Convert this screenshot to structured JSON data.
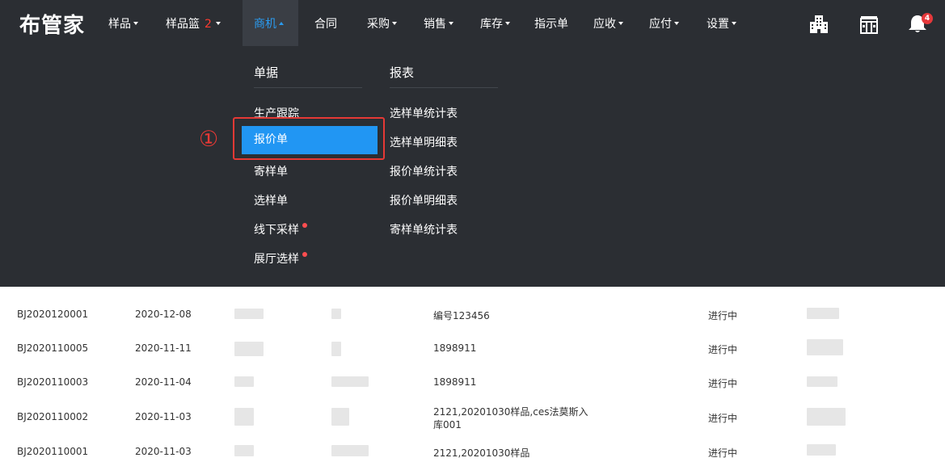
{
  "app": {
    "logo": "布管家"
  },
  "nav": {
    "items": [
      {
        "label": "样品"
      },
      {
        "label": "样品篮",
        "badge": "2"
      },
      {
        "label": "商机"
      },
      {
        "label": "合同"
      },
      {
        "label": "采购"
      },
      {
        "label": "销售"
      },
      {
        "label": "库存"
      },
      {
        "label": "指示单"
      },
      {
        "label": "应收"
      },
      {
        "label": "应付"
      },
      {
        "label": "设置"
      }
    ],
    "active_item": "商机",
    "icons": [
      "building-icon",
      "store-icon",
      "bell-icon"
    ],
    "notification_count": "4"
  },
  "dropdown": {
    "documents": {
      "title": "单据",
      "items": [
        "生产跟踪",
        "报价单",
        "寄样单",
        "选样单",
        "线下采样",
        "展厅选样"
      ],
      "highlighted": "报价单"
    },
    "reports": {
      "title": "报表",
      "items": [
        "选样单统计表",
        "选样单明细表",
        "报价单统计表",
        "报价单明细表",
        "寄样单统计表"
      ]
    }
  },
  "annotation": {
    "number": "①"
  },
  "table": {
    "rows": [
      {
        "no": "BJ2020120001",
        "date": "2020-12-08",
        "remark": "编号123456",
        "remark2": "",
        "status": "进行中"
      },
      {
        "no": "BJ2020110005",
        "date": "2020-11-11",
        "remark": "1898911",
        "remark2": "",
        "status": "进行中"
      },
      {
        "no": "BJ2020110003",
        "date": "2020-11-04",
        "remark": "1898911",
        "remark2": "",
        "status": "进行中"
      },
      {
        "no": "BJ2020110002",
        "date": "2020-11-03",
        "remark": "2121,20201030样品,ces法莫斯入",
        "remark2": "库001",
        "status": "进行中"
      },
      {
        "no": "BJ2020110001",
        "date": "2020-11-03",
        "remark": "2121,20201030样品",
        "remark2": "",
        "status": "进行中"
      }
    ]
  },
  "colors": {
    "topbar": "#2b2e33",
    "active_nav": "#2a9bf0",
    "highlight": "#2196f3",
    "annotation": "#e53935",
    "dot": "#ff4d4f"
  }
}
